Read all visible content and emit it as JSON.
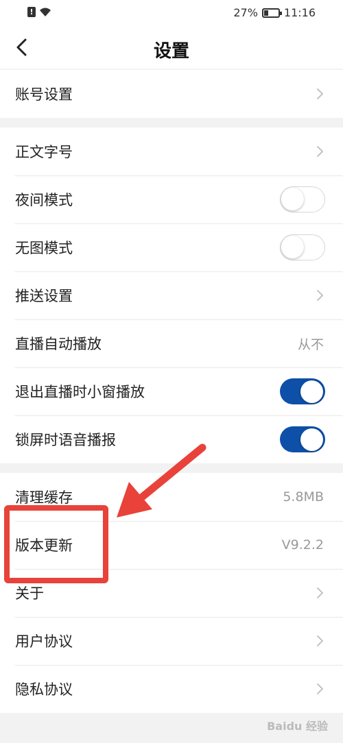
{
  "status_bar": {
    "sim_label": "!",
    "battery_percent": "27%",
    "battery_level": 0.27,
    "time": "11:16"
  },
  "header": {
    "title": "设置",
    "back_icon": "chevron-left-icon"
  },
  "groups": [
    {
      "items": [
        {
          "label": "账号设置",
          "control": "chevron"
        }
      ]
    },
    {
      "items": [
        {
          "label": "正文字号",
          "control": "chevron"
        },
        {
          "label": "夜间模式",
          "control": "toggle",
          "on": false
        },
        {
          "label": "无图模式",
          "control": "toggle",
          "on": false
        },
        {
          "label": "推送设置",
          "control": "chevron"
        },
        {
          "label": "直播自动播放",
          "control": "value",
          "value": "从不"
        },
        {
          "label": "退出直播时小窗播放",
          "control": "toggle",
          "on": true
        },
        {
          "label": "锁屏时语音播报",
          "control": "toggle",
          "on": true
        }
      ]
    },
    {
      "items": [
        {
          "label": "清理缓存",
          "control": "value",
          "value": "5.8MB"
        },
        {
          "label": "版本更新",
          "control": "value",
          "value": "V9.2.2"
        },
        {
          "label": "关于",
          "control": "chevron"
        },
        {
          "label": "用户协议",
          "control": "chevron"
        },
        {
          "label": "隐私协议",
          "control": "chevron"
        }
      ]
    }
  ],
  "colors": {
    "toggle_on": "#0e4fa8",
    "annotation": "#e8423a"
  },
  "watermark": "Baidu 经验"
}
